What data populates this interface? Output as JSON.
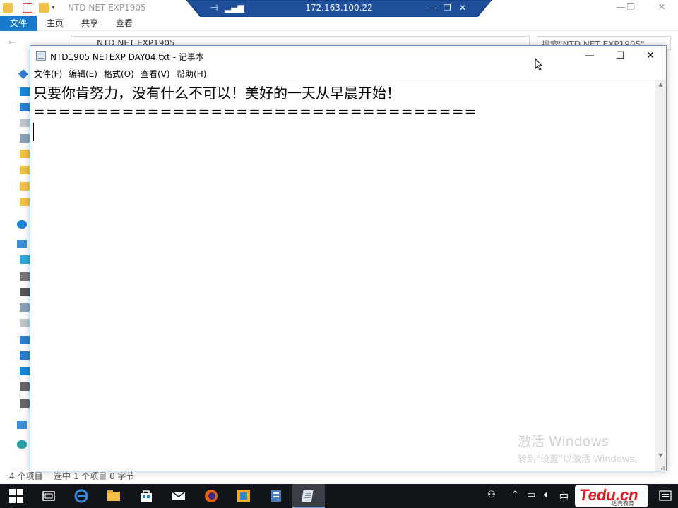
{
  "explorer": {
    "title": "NTD NET EXP1905",
    "ribbon": {
      "file": "文件",
      "home": "主页",
      "share": "共享",
      "view": "查看"
    },
    "address": "NTD NET EXP1905",
    "search_placeholder": "搜索\"NTD NET EXP1905\"",
    "status_items": "4 个项目",
    "status_selected": "选中 1 个项目  0 字节"
  },
  "rdp": {
    "host": "172.163.100.22"
  },
  "notepad": {
    "title": "NTD1905 NETEXP DAY04.txt - 记事本",
    "menu": {
      "file": "文件(F)",
      "edit": "编辑(E)",
      "format": "格式(O)",
      "view": "查看(V)",
      "help": "帮助(H)"
    },
    "lines": [
      "只要你肯努力，没有什么不可以！美好的一天从早晨开始！",
      "==================================="
    ]
  },
  "watermark": {
    "line1": "激活 Windows",
    "line2": "转到\"设置\"以激活 Windows。"
  },
  "taskbar": {
    "ime": "中",
    "brand": "Tedu.cn",
    "brand_sub": "达内教育"
  },
  "colors": {
    "ribbon_file": "#1979ca",
    "rdp_bar": "#1f4f9a",
    "taskbar": "#111418",
    "brand": "#d81e23"
  }
}
